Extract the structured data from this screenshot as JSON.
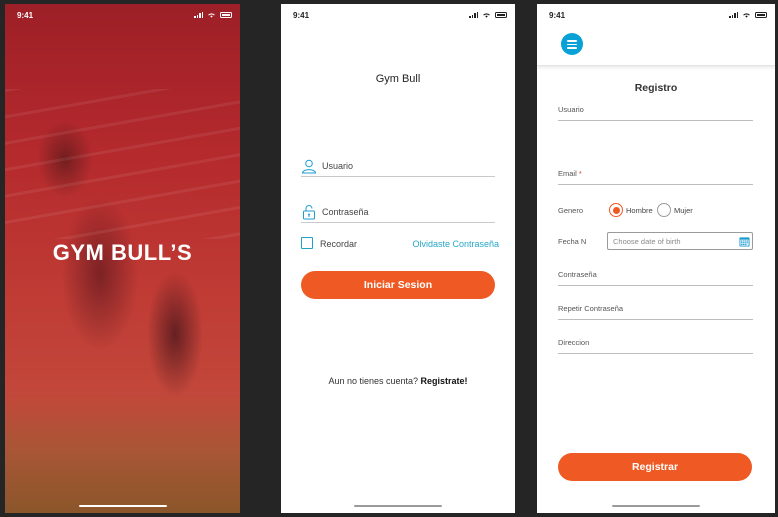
{
  "screens": {
    "splash": {
      "time": "9:41",
      "title": "GYM BULL’S",
      "colors": {
        "overlay": "#b3262a",
        "text": "#ffffff"
      }
    },
    "login": {
      "time": "9:41",
      "title": "Gym Bull",
      "usuario_label": "Usuario",
      "contrasena_label": "Contraseña",
      "recordar_label": "Recordar",
      "forgot_label": "Olvidaste Contraseña",
      "login_button": "Iniciar Sesion",
      "signup_prompt": "Aun no tienes cuenta?",
      "signup_link": "Registrate!",
      "colors": {
        "accent": "#ef5a24",
        "link": "#26a8c6"
      }
    },
    "registro": {
      "time": "9:41",
      "title": "Registro",
      "fields": {
        "usuario": "Usuario",
        "email": "Email",
        "email_required": "*",
        "genero": "Genero",
        "genero_options": [
          "Hombre",
          "Mujer"
        ],
        "genero_selected": "Hombre",
        "fecha": "Fecha N",
        "fecha_placeholder": "Choose date of birth",
        "contrasena": "Contraseña",
        "repetir": "Repetir Contraseña",
        "direccion": "Direccion"
      },
      "register_button": "Registrar",
      "colors": {
        "menu": "#0aa2d6",
        "accent": "#ef5a24",
        "calendar": "#1d9bd1"
      }
    }
  }
}
